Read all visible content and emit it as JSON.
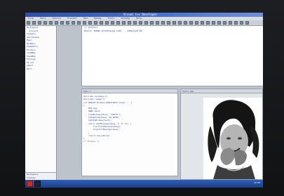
{
  "window": {
    "title": "Visual C++ Developer"
  },
  "menubar": {
    "items": [
      "File",
      "Edit",
      "Search",
      "Project",
      "Run",
      "Debug",
      "Tools",
      "Window",
      "Help"
    ]
  },
  "toolbar": {
    "button_count": 40
  },
  "left_panel": {
    "lines": [
      "Workspace",
      "  - project",
      "    Globals",
      "    Attributes",
      "",
      "  Main",
      "    WinMain",
      "    ImageProc",
      "    Filters",
      "    LoadBmp",
      "    SaveBmp",
      "  Dialogs",
      "    Ok Cnl",
      "    About",
      "  Rsrc"
    ],
    "bottom_lines": [
      "Workspace",
      "  Classes",
      "  Files",
      "  Resources",
      "Ready"
    ]
  },
  "top_pane": {
    "lines": [
      "// project",
      "Build: Image processing tool -- compiled OK",
      ""
    ]
  },
  "code_pane": {
    "title": "main.c",
    "lines": [
      "#include <windows.h>",
      "#include \"image.h\"",
      "",
      "int WINAPI WinMain(HINSTANCE hInst, ...)",
      "{",
      "    MSG msg;",
      "    HWND hwnd;",
      "    LoadBitmap(hInst, \"PHOTO\");",
      "    ShowWindow(hwnd, SW_SHOW);",
      "    UpdateWindow(hwnd);",
      "    while (GetMessage(&msg, 0, 0, 0)) {",
      "        TranslateMessage(&msg);",
      "        DispatchMessage(&msg);",
      "    }",
      "    return msg.wParam;",
      "}",
      "",
      "/* filters */",
      "",
      "",
      "",
      "",
      "",
      "",
      ""
    ]
  },
  "image_pane": {
    "title": "Photo.bmp"
  },
  "taskbar": {
    "tray": "12:00"
  },
  "colors": {
    "titlebar": "#2d4fa8",
    "taskbar": "#2f5eb8",
    "code_text": "#3a4f9a"
  }
}
